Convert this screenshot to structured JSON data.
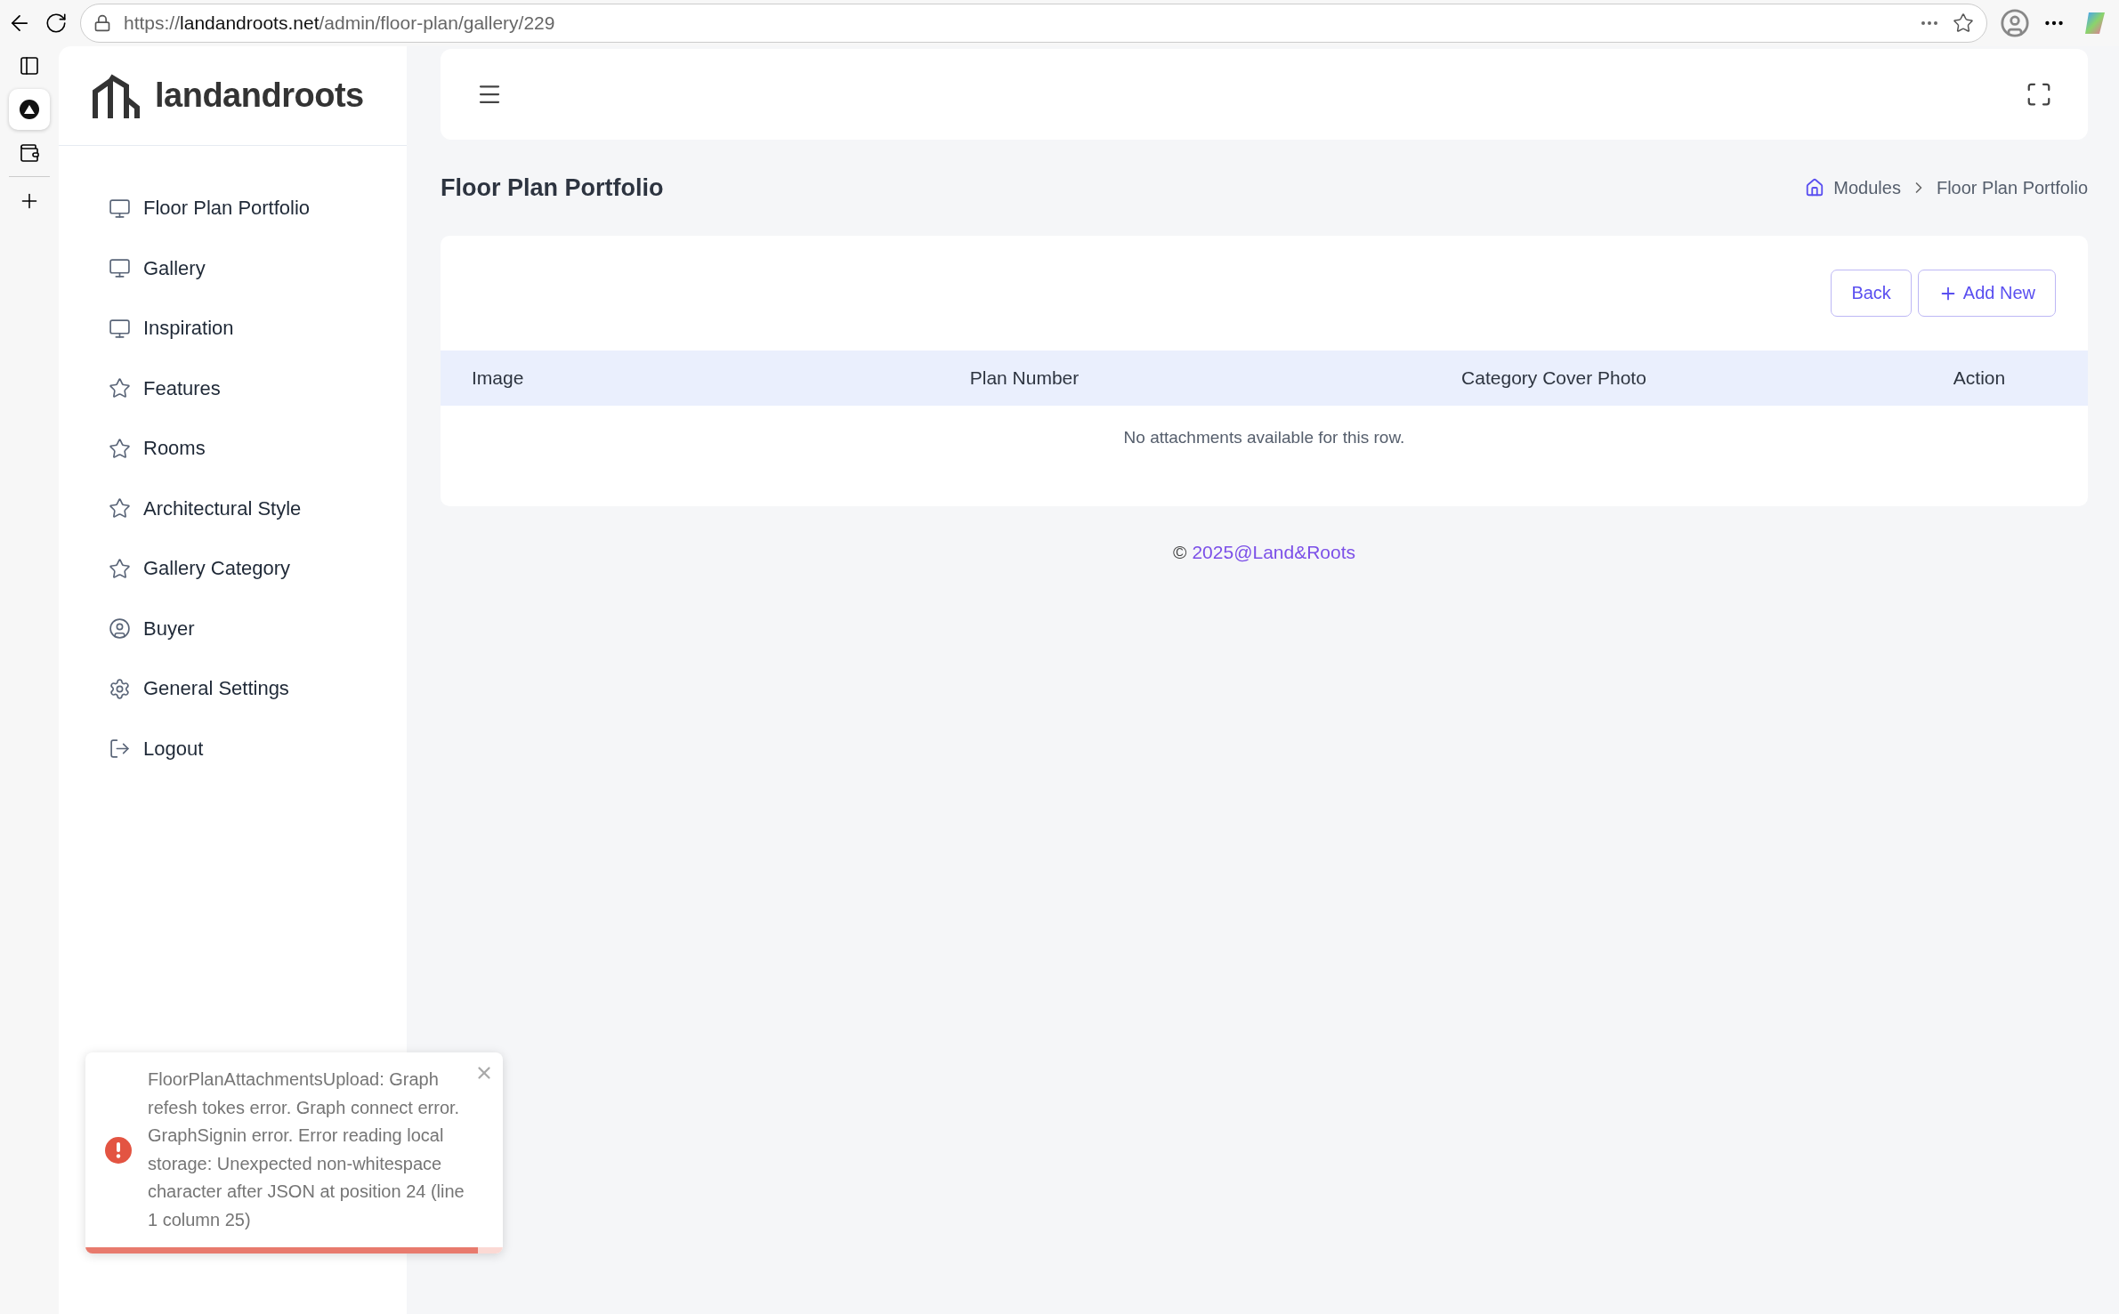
{
  "browser": {
    "url": {
      "scheme": "https://",
      "host": "landandroots.net",
      "path": "/admin/floor-plan/gallery/229"
    }
  },
  "sidebar": {
    "brand": "landandroots",
    "items": [
      {
        "label": "Floor Plan Portfolio",
        "kind": "monitor"
      },
      {
        "label": "Gallery",
        "kind": "monitor"
      },
      {
        "label": "Inspiration",
        "kind": "monitor"
      },
      {
        "label": "Features",
        "kind": "star"
      },
      {
        "label": "Rooms",
        "kind": "star"
      },
      {
        "label": "Architectural Style",
        "kind": "star"
      },
      {
        "label": "Gallery Category",
        "kind": "star"
      },
      {
        "label": "Buyer",
        "kind": "user"
      },
      {
        "label": "General Settings",
        "kind": "gear"
      },
      {
        "label": "Logout",
        "kind": "logout"
      }
    ]
  },
  "page": {
    "title": "Floor Plan Portfolio",
    "breadcrumb": [
      "Modules",
      "Floor Plan Portfolio"
    ]
  },
  "actions": [
    {
      "label": "Back",
      "kind": "plain"
    },
    {
      "label": "Add New",
      "kind": "add"
    }
  ],
  "table": {
    "columns": [
      "Image",
      "Plan Number",
      "Category Cover Photo",
      "Action"
    ],
    "empty_message": "No attachments available for this row."
  },
  "footer": {
    "symbol": "©",
    "link": "2025@Land&Roots"
  },
  "toast": {
    "message": "FloorPlanAttachmentsUpload: Graph refesh tokes error. Graph connect error. GraphSignin error. Error reading local storage: Unexpected non-whitespace character after JSON at position 24 (line 1 column 25)",
    "level": 0.94
  }
}
